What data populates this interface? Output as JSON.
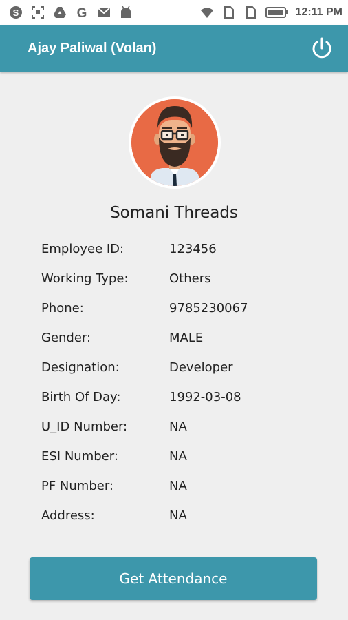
{
  "status_bar": {
    "time": "12:11 PM",
    "icons_left": [
      "skype-icon",
      "screenshot-icon",
      "drive-icon",
      "google-icon",
      "gmail-icon",
      "android-icon"
    ],
    "icons_right": [
      "wifi-icon",
      "sim1-icon",
      "sim2-icon",
      "battery-icon"
    ]
  },
  "app_bar": {
    "title": "Ajay Paliwal (Volan)",
    "power_icon": "power-icon",
    "color": "#3d97ab"
  },
  "profile": {
    "company": "Somani Threads",
    "avatar_bg": "#e86a45"
  },
  "details": [
    {
      "label": "Employee ID:",
      "value": "123456"
    },
    {
      "label": "Working Type:",
      "value": "Others"
    },
    {
      "label": "Phone:",
      "value": "9785230067"
    },
    {
      "label": "Gender:",
      "value": "MALE"
    },
    {
      "label": "Designation:",
      "value": "Developer"
    },
    {
      "label": "Birth Of Day:",
      "value": "1992-03-08"
    },
    {
      "label": "U_ID Number:",
      "value": "NA"
    },
    {
      "label": "ESI Number:",
      "value": "NA"
    },
    {
      "label": "PF Number:",
      "value": "NA"
    },
    {
      "label": "Address:",
      "value": "NA"
    }
  ],
  "action": {
    "label": "Get Attendance"
  }
}
